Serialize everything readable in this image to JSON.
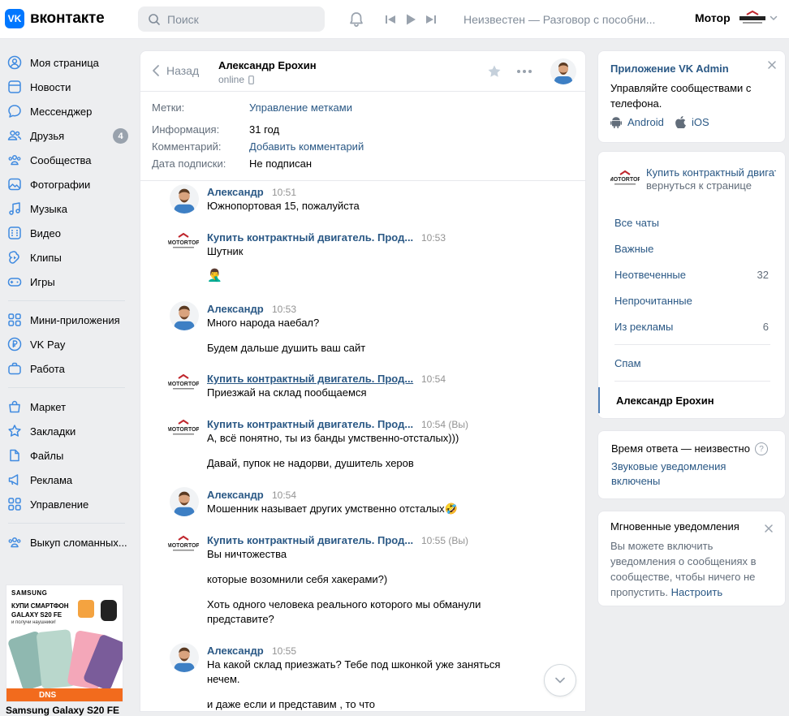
{
  "header": {
    "logo_letters": "VK",
    "logo_text": "вконтакте",
    "search_placeholder": "Поиск",
    "track": "Неизвестен — Разговор с пособни...",
    "profile_name": "Мотор"
  },
  "sidebar": {
    "items": [
      {
        "label": "Моя страница",
        "icon": "user-circle-icon"
      },
      {
        "label": "Новости",
        "icon": "news-icon"
      },
      {
        "label": "Мессенджер",
        "icon": "message-icon"
      },
      {
        "label": "Друзья",
        "icon": "friends-icon",
        "badge": "4"
      },
      {
        "label": "Сообщества",
        "icon": "communities-icon"
      },
      {
        "label": "Фотографии",
        "icon": "photo-icon"
      },
      {
        "label": "Музыка",
        "icon": "music-icon"
      },
      {
        "label": "Видео",
        "icon": "video-icon"
      },
      {
        "label": "Клипы",
        "icon": "clips-icon"
      },
      {
        "label": "Игры",
        "icon": "gamepad-icon"
      },
      {
        "label": "Мини-приложения",
        "icon": "apps-icon"
      },
      {
        "label": "VK Pay",
        "icon": "pay-icon"
      },
      {
        "label": "Работа",
        "icon": "briefcase-icon"
      },
      {
        "label": "Маркет",
        "icon": "bag-icon"
      },
      {
        "label": "Закладки",
        "icon": "star-icon"
      },
      {
        "label": "Файлы",
        "icon": "file-icon"
      },
      {
        "label": "Реклама",
        "icon": "megaphone-icon"
      },
      {
        "label": "Управление",
        "icon": "grid-icon"
      },
      {
        "label": "Выкуп сломанных...",
        "icon": "group-icon"
      }
    ],
    "ad": {
      "brand": "SAMSUNG",
      "title": "КУПИ СМАРТФОН GALAXY S20 FE",
      "sub": "и получи наушники!",
      "store": "DNS",
      "caption": "Samsung Galaxy S20 FE"
    }
  },
  "chat": {
    "back_label": "Назад",
    "peer_name": "Александр Ерохин",
    "peer_status": "online",
    "info": {
      "tags_key": "Метки:",
      "tags_value": "Управление метками",
      "info_key": "Информация:",
      "info_value": "31 год",
      "comment_key": "Комментарий:",
      "comment_value": "Добавить комментарий",
      "sub_key": "Дата подписки:",
      "sub_value": "Не подписан"
    },
    "messages": [
      {
        "author": "Александр",
        "time": "10:51",
        "lines": [
          "Южнопортовая 15, пожалуйста"
        ],
        "kind": "user"
      },
      {
        "author": "Купить контрактный двигатель. Прод...",
        "time": "10:53",
        "lines": [
          "Шутник",
          "🤦‍♂️"
        ],
        "kind": "group"
      },
      {
        "author": "Александр",
        "time": "10:53",
        "lines": [
          "Много народа наебал?",
          "Будем дальше душить ваш сайт"
        ],
        "kind": "user"
      },
      {
        "author": "Купить контрактный двигатель. Прод...",
        "time": "10:54",
        "lines": [
          "Приезжай на склад пообщаемся"
        ],
        "kind": "group"
      },
      {
        "author": "Купить контрактный двигатель. Прод...",
        "time": "10:54 (Вы)",
        "lines": [
          "А, всё понятно, ты из банды умственно-отсталых)))",
          "Давай, пупок не надорви, душитель херов"
        ],
        "kind": "group"
      },
      {
        "author": "Александр",
        "time": "10:54",
        "lines": [
          "Мошенник называет других умственно отсталых🤣"
        ],
        "kind": "user"
      },
      {
        "author": "Купить контрактный двигатель. Прод...",
        "time": "10:55 (Вы)",
        "lines": [
          "Вы ничтожества",
          "которые возомнили себя хакерами?)",
          "Хоть одного человека реального которого мы обманули",
          "представите?"
        ],
        "kind": "group"
      },
      {
        "author": "Александр",
        "time": "10:55",
        "lines": [
          "На какой склад приезжать? Тебе под шконкой уже заняться",
          "нечем.",
          "и даже если и представим , то что"
        ],
        "kind": "user"
      }
    ]
  },
  "right": {
    "app_card": {
      "title": "Приложение VK Admin",
      "text": "Управляйте сообществами с телефона.",
      "android": "Android",
      "ios": "iOS"
    },
    "group_card": {
      "group_name": "Купить контрактный двигатель...",
      "return": "вернуться к странице",
      "folders": [
        {
          "label": "Все чаты",
          "count": ""
        },
        {
          "label": "Важные",
          "count": ""
        },
        {
          "label": "Неотвеченные",
          "count": "32"
        },
        {
          "label": "Непрочитанные",
          "count": ""
        },
        {
          "label": "Из рекламы",
          "count": "6"
        },
        {
          "label": "Спам",
          "count": ""
        }
      ],
      "active_peer": "Александр Ерохин"
    },
    "response_card": {
      "text": "Время ответа — неизвестно",
      "help": "?",
      "link": "Звуковые уведомления включены"
    },
    "notify_card": {
      "title": "Мгновенные уведомления",
      "text": "Вы можете включить уведомления о сообщениях в сообществе, чтобы ничего не пропустить.",
      "link": "Настроить"
    }
  }
}
